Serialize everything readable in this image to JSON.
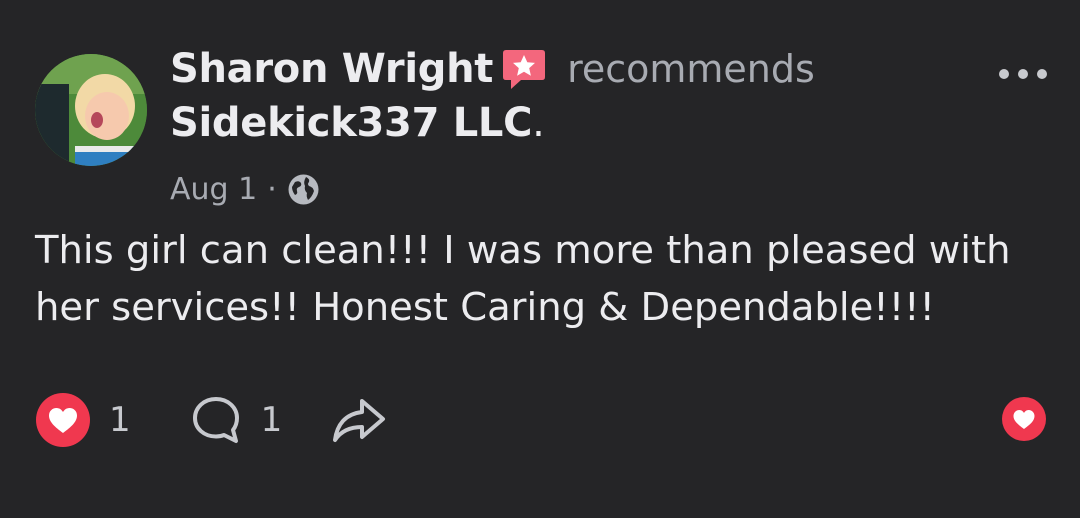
{
  "post": {
    "author": "Sharon Wright",
    "verb": "recommends",
    "business": "Sidekick337 LLC",
    "business_suffix": ".",
    "date": "Aug 1",
    "separator": "·",
    "body": "This girl can clean!!! I was more than pleased with her services!! Honest Caring & Dependable!!!!"
  },
  "actions": {
    "like_count": "1",
    "comment_count": "1"
  },
  "icons": {
    "recommend": "recommend-star-icon",
    "privacy": "globe-icon",
    "more": "more-options-icon",
    "like": "heart-icon",
    "comment": "comment-icon",
    "share": "share-icon",
    "react": "heart-react-icon"
  },
  "colors": {
    "background": "#252527",
    "like_red": "#f0384f",
    "recommend_pink": "#f3677d",
    "text": "#ececef",
    "muted": "#a8abb2"
  }
}
